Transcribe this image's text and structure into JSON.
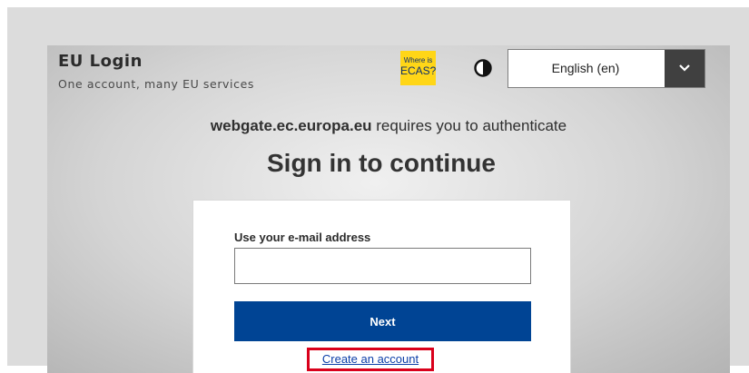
{
  "header": {
    "brand_title": "EU Login",
    "brand_subtitle": "One account, many EU services",
    "ecas_badge": {
      "line1": "Where is",
      "line2": "ECAS?"
    },
    "contrast_icon": "contrast-icon",
    "language": {
      "selected": "English (en)",
      "caret_icon": "chevron-down-icon"
    }
  },
  "main": {
    "auth_host": "webgate.ec.europa.eu",
    "auth_suffix": " requires you to authenticate",
    "title": "Sign in to continue"
  },
  "form": {
    "email_label": "Use your e-mail address",
    "email_value": "",
    "email_placeholder": "",
    "next_label": "Next",
    "create_account_label": "Create an account"
  },
  "colors": {
    "primary_blue": "#004494",
    "badge_yellow": "#ffd617",
    "highlight_red": "#d9001b",
    "link_blue": "#0b3ea8"
  }
}
